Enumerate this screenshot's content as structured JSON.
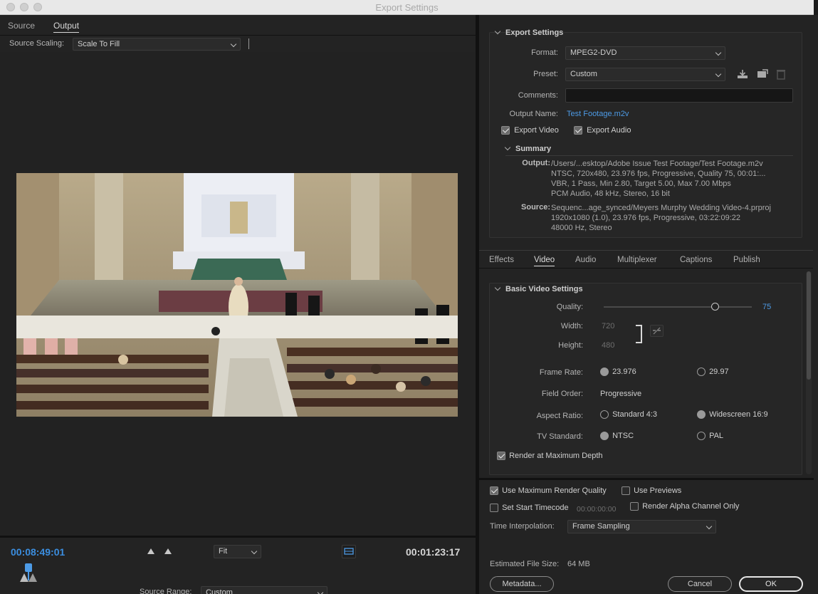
{
  "window": {
    "title": "Export Settings"
  },
  "left": {
    "tabs": [
      {
        "label": "Source"
      },
      {
        "label": "Output"
      }
    ],
    "source_scaling": {
      "label": "Source Scaling:",
      "value": "Scale To Fill"
    },
    "timecode_current": "00:08:49:01",
    "timecode_duration": "00:01:23:17",
    "zoom": "Fit",
    "source_range": {
      "label": "Source Range:",
      "value": "Custom"
    }
  },
  "export_settings": {
    "title": "Export Settings",
    "format": {
      "label": "Format:",
      "value": "MPEG2-DVD"
    },
    "preset": {
      "label": "Preset:",
      "value": "Custom"
    },
    "comments": {
      "label": "Comments:",
      "value": ""
    },
    "output_name": {
      "label": "Output Name:",
      "value": "Test Footage.m2v"
    },
    "export_video": "Export Video",
    "export_audio": "Export Audio",
    "summary": {
      "title": "Summary",
      "output_label": "Output:",
      "output_lines": [
        "/Users/...esktop/Adobe Issue Test Footage/Test Footage.m2v",
        "NTSC, 720x480, 23.976 fps, Progressive, Quality 75, 00:01:...",
        "VBR, 1 Pass, Min 2.80, Target 5.00, Max 7.00 Mbps",
        "PCM Audio, 48 kHz, Stereo, 16 bit"
      ],
      "source_label": "Source:",
      "source_lines": [
        "Sequenc...age_synced/Meyers Murphy Wedding Video-4.prproj",
        "1920x1080 (1.0), 23.976 fps, Progressive, 03:22:09:22",
        "48000 Hz, Stereo"
      ]
    }
  },
  "settings_tabs": [
    {
      "label": "Effects"
    },
    {
      "label": "Video"
    },
    {
      "label": "Audio"
    },
    {
      "label": "Multiplexer"
    },
    {
      "label": "Captions"
    },
    {
      "label": "Publish"
    }
  ],
  "basic_video": {
    "title": "Basic Video Settings",
    "quality": {
      "label": "Quality:",
      "value": "75",
      "level": 0.75
    },
    "width": {
      "label": "Width:",
      "value": "720"
    },
    "height": {
      "label": "Height:",
      "value": "480"
    },
    "frame_rate": {
      "label": "Frame Rate:",
      "opt1": "23.976",
      "opt2": "29.97"
    },
    "field_order": {
      "label": "Field Order:",
      "value": "Progressive"
    },
    "aspect_ratio": {
      "label": "Aspect Ratio:",
      "opt1": "Standard 4:3",
      "opt2": "Widescreen 16:9"
    },
    "tv_standard": {
      "label": "TV Standard:",
      "opt1": "NTSC",
      "opt2": "PAL"
    },
    "render_max_depth": "Render at Maximum Depth"
  },
  "bottom": {
    "use_max_render_quality": "Use Maximum Render Quality",
    "use_previews": "Use Previews",
    "set_start_timecode": "Set Start Timecode",
    "start_timecode_value": "00:00:00:00",
    "render_alpha": "Render Alpha Channel Only",
    "time_interpolation": {
      "label": "Time Interpolation:",
      "value": "Frame Sampling"
    },
    "estimated_size": {
      "label": "Estimated File Size:",
      "value": "64 MB"
    },
    "metadata_btn": "Metadata...",
    "cancel_btn": "Cancel",
    "ok_btn": "OK"
  },
  "colors": {
    "accent": "#4d9be6",
    "panel": "#232323"
  }
}
